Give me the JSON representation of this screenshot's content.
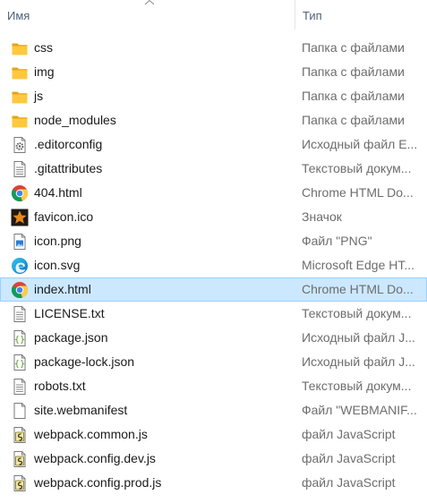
{
  "header": {
    "name_label": "Имя",
    "type_label": "Тип"
  },
  "files": [
    {
      "name": "css",
      "type": "Папка с файлами",
      "icon": "folder-icon"
    },
    {
      "name": "img",
      "type": "Папка с файлами",
      "icon": "folder-icon"
    },
    {
      "name": "js",
      "type": "Папка с файлами",
      "icon": "folder-icon"
    },
    {
      "name": "node_modules",
      "type": "Папка с файлами",
      "icon": "folder-icon"
    },
    {
      "name": ".editorconfig",
      "type": "Исходный файл E...",
      "icon": "gear-file-icon"
    },
    {
      "name": ".gitattributes",
      "type": "Текстовый докум...",
      "icon": "text-file-icon"
    },
    {
      "name": "404.html",
      "type": "Chrome HTML Do...",
      "icon": "chrome-icon"
    },
    {
      "name": "favicon.ico",
      "type": "Значок",
      "icon": "star-icon"
    },
    {
      "name": "icon.png",
      "type": "Файл \"PNG\"",
      "icon": "image-file-icon"
    },
    {
      "name": "icon.svg",
      "type": "Microsoft Edge HT...",
      "icon": "edge-icon"
    },
    {
      "name": "index.html",
      "type": "Chrome HTML Do...",
      "icon": "chrome-icon",
      "selected": true
    },
    {
      "name": "LICENSE.txt",
      "type": "Текстовый докум...",
      "icon": "text-file-icon"
    },
    {
      "name": "package.json",
      "type": "Исходный файл J...",
      "icon": "json-file-icon"
    },
    {
      "name": "package-lock.json",
      "type": "Исходный файл J...",
      "icon": "json-file-icon"
    },
    {
      "name": "robots.txt",
      "type": "Текстовый докум...",
      "icon": "text-file-icon"
    },
    {
      "name": "site.webmanifest",
      "type": "Файл \"WEBMANIF...",
      "icon": "blank-file-icon"
    },
    {
      "name": "webpack.common.js",
      "type": "файл JavaScript",
      "icon": "js-file-icon"
    },
    {
      "name": "webpack.config.dev.js",
      "type": "файл JavaScript",
      "icon": "js-file-icon"
    },
    {
      "name": "webpack.config.prod.js",
      "type": "файл JavaScript",
      "icon": "js-file-icon"
    }
  ]
}
